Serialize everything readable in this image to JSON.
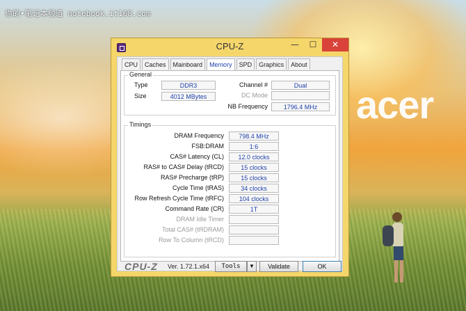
{
  "watermark": "你的•笔记本频道 notebook.it168.com",
  "desktop_brand": "acer",
  "window": {
    "title": "CPU-Z",
    "minimize": "—",
    "maximize": "☐",
    "close": "✕",
    "tabs": [
      {
        "label": "CPU",
        "active": false
      },
      {
        "label": "Caches",
        "active": false
      },
      {
        "label": "Mainboard",
        "active": false
      },
      {
        "label": "Memory",
        "active": true
      },
      {
        "label": "SPD",
        "active": false
      },
      {
        "label": "Graphics",
        "active": false
      },
      {
        "label": "About",
        "active": false
      }
    ]
  },
  "general": {
    "title": "General",
    "type_label": "Type",
    "type_value": "DDR3",
    "size_label": "Size",
    "size_value": "4012 MBytes",
    "channel_label": "Channel #",
    "channel_value": "Dual",
    "dcmode_label": "DC Mode",
    "dcmode_value": "",
    "nbfreq_label": "NB Frequency",
    "nbfreq_value": "1796.4 MHz"
  },
  "timings": {
    "title": "Timings",
    "rows": [
      {
        "label": "DRAM Frequency",
        "value": "798.4 MHz",
        "dim": false
      },
      {
        "label": "FSB:DRAM",
        "value": "1:6",
        "dim": false
      },
      {
        "label": "CAS# Latency (CL)",
        "value": "12.0 clocks",
        "dim": false
      },
      {
        "label": "RAS# to CAS# Delay (tRCD)",
        "value": "15 clocks",
        "dim": false
      },
      {
        "label": "RAS# Precharge (tRP)",
        "value": "15 clocks",
        "dim": false
      },
      {
        "label": "Cycle Time (tRAS)",
        "value": "34 clocks",
        "dim": false
      },
      {
        "label": "Row Refresh Cycle Time (tRFC)",
        "value": "104 clocks",
        "dim": false
      },
      {
        "label": "Command Rate (CR)",
        "value": "1T",
        "dim": false
      },
      {
        "label": "DRAM Idle Timer",
        "value": "",
        "dim": true
      },
      {
        "label": "Total CAS# (tRDRAM)",
        "value": "",
        "dim": true
      },
      {
        "label": "Row To Column (tRCD)",
        "value": "",
        "dim": true
      }
    ]
  },
  "footer": {
    "logo": "CPU-Z",
    "version": "Ver. 1.72.1.x64",
    "tools_label": "Tools",
    "tools_arrow": "▼",
    "validate_label": "Validate",
    "ok_label": "OK"
  }
}
